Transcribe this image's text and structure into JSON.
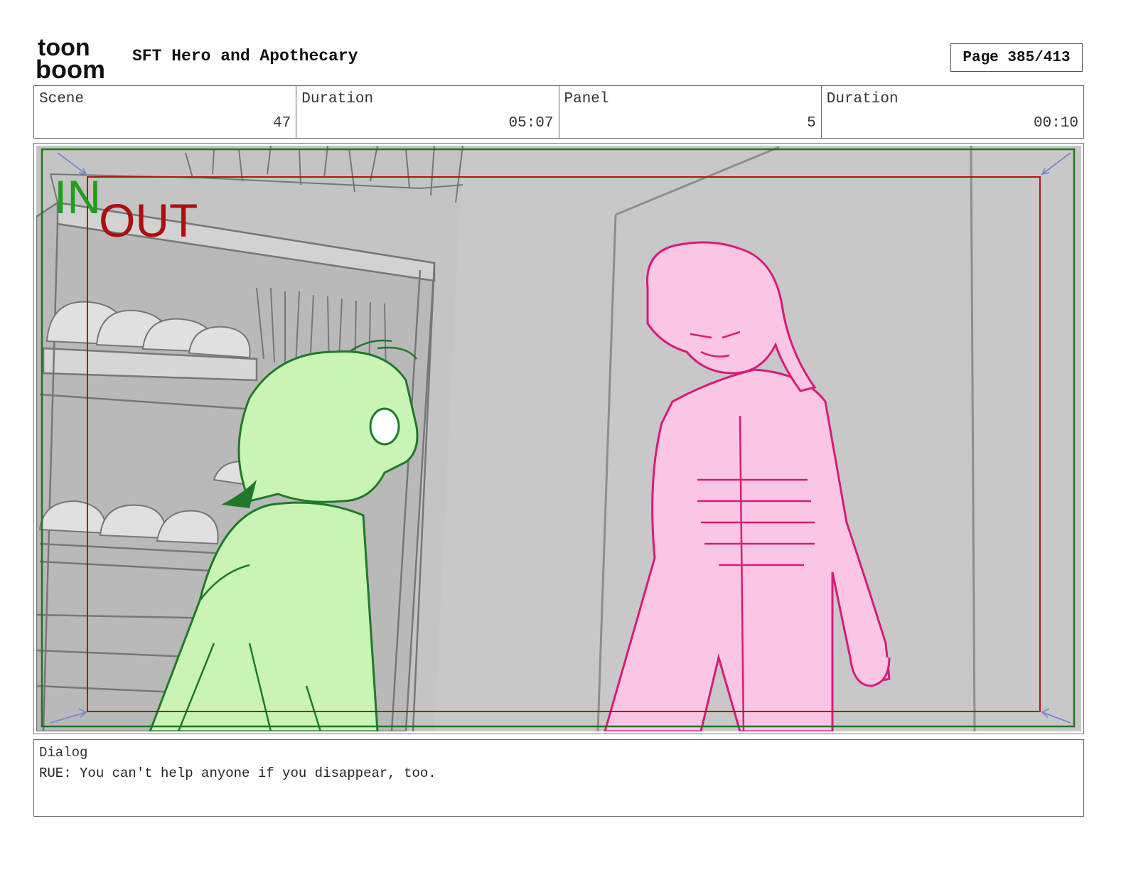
{
  "header": {
    "logo_text_top": "toon",
    "logo_text_bottom": "boom",
    "project_title": "SFT Hero and Apothecary",
    "page_label": "Page 385/413"
  },
  "info": {
    "scene_label": "Scene",
    "scene_value": "47",
    "scene_duration_label": "Duration",
    "scene_duration_value": "05:07",
    "panel_label": "Panel",
    "panel_value": "5",
    "panel_duration_label": "Duration",
    "panel_duration_value": "00:10"
  },
  "panel": {
    "in_label": "IN",
    "out_label": "OUT",
    "in_color": "#1aa21a",
    "out_color": "#aa1010",
    "green_char_color": "#c9f5b4",
    "green_line_color": "#1e7a2a",
    "pink_char_color": "#fbc6e4",
    "pink_line_color": "#d81b7a",
    "background_gray": "#c4c4c4"
  },
  "dialog": {
    "label": "Dialog",
    "text": "RUE: You can't help anyone if you disappear, too."
  }
}
